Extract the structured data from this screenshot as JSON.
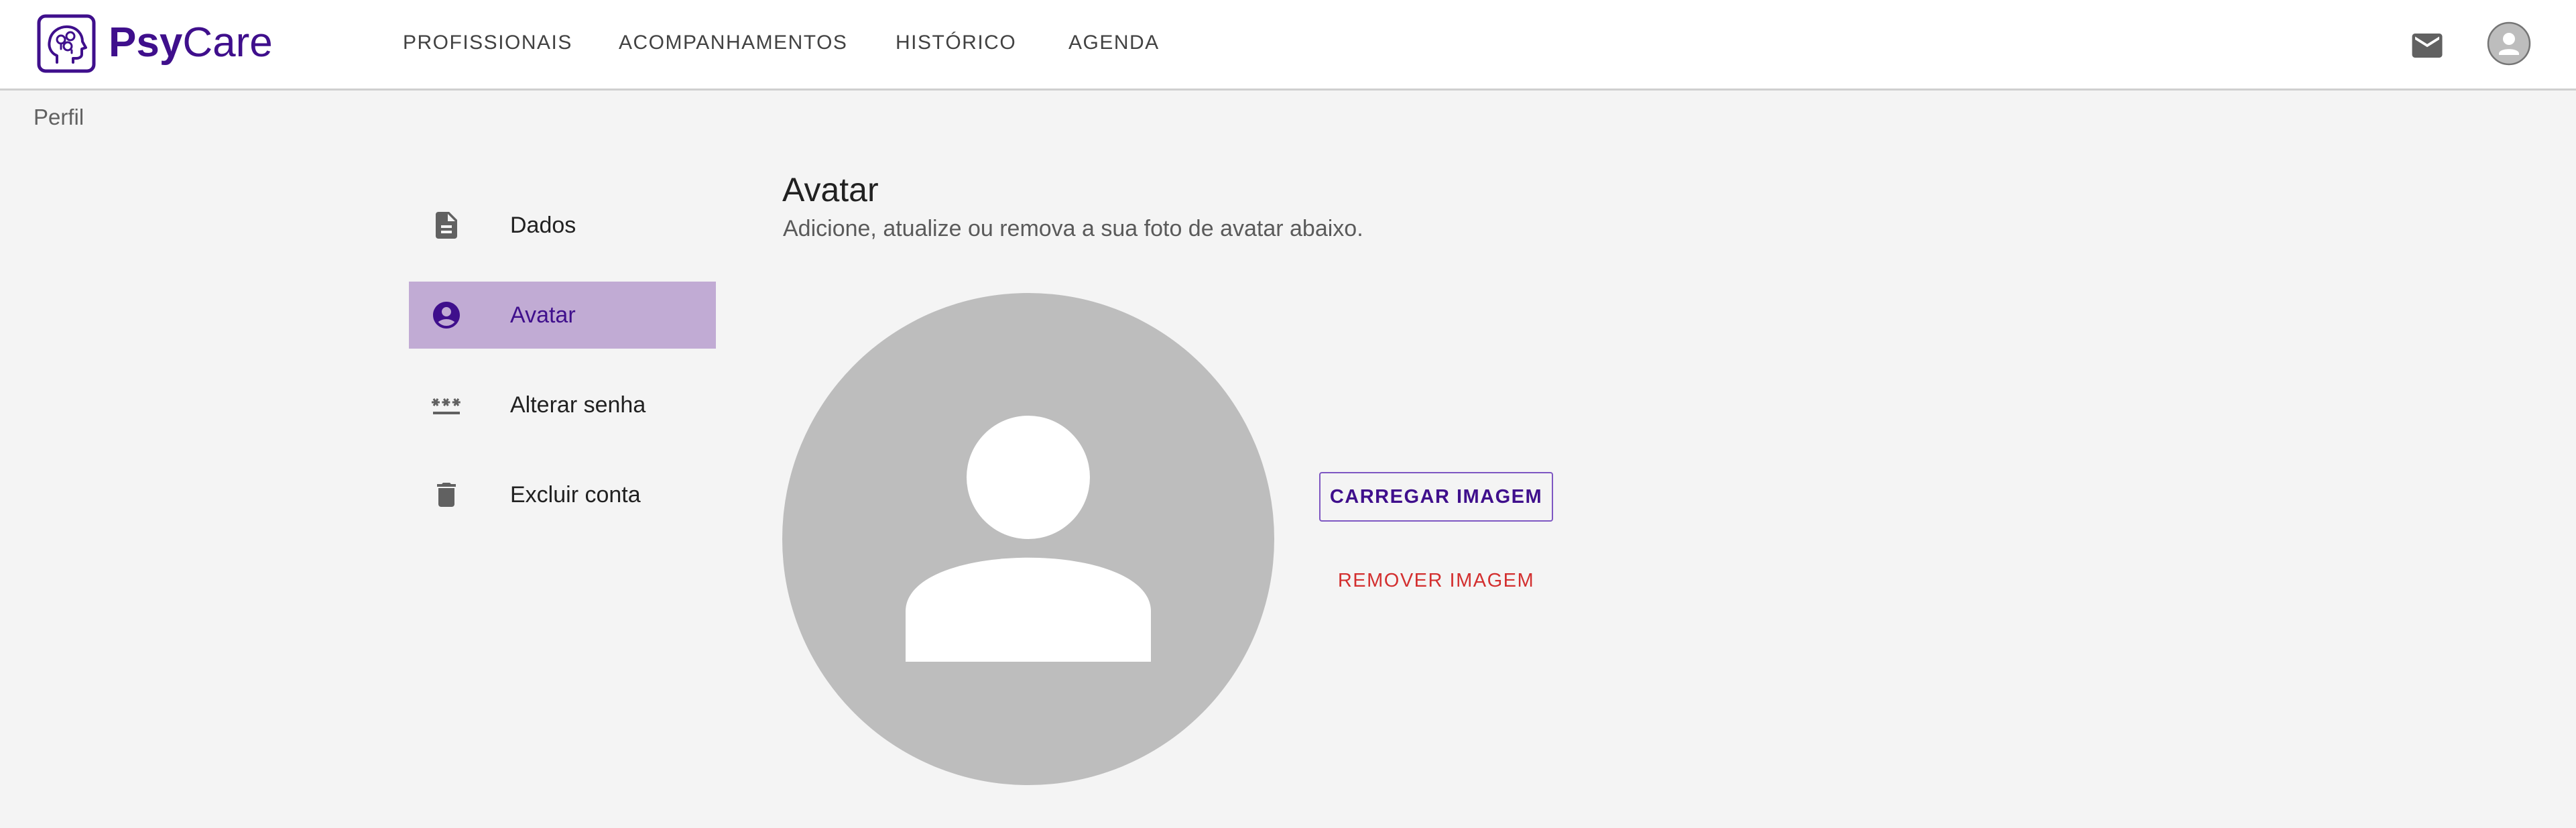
{
  "brand": {
    "part1": "Psy",
    "part2": "Care"
  },
  "nav": [
    {
      "label": "PROFISSIONAIS"
    },
    {
      "label": "ACOMPANHAMENTOS"
    },
    {
      "label": "HISTÓRICO"
    },
    {
      "label": "AGENDA"
    }
  ],
  "header_icons": {
    "mail": "mail-icon",
    "account": "account-circle-icon"
  },
  "breadcrumb": "Perfil",
  "sidebar": {
    "active_index": 1,
    "items": [
      {
        "label": "Dados",
        "icon": "description-icon"
      },
      {
        "label": "Avatar",
        "icon": "account-circle-icon"
      },
      {
        "label": "Alterar senha",
        "icon": "password-icon"
      },
      {
        "label": "Excluir conta",
        "icon": "delete-icon"
      }
    ]
  },
  "section": {
    "title": "Avatar",
    "subtitle": "Adicione, atualize ou remova a sua foto de avatar abaixo."
  },
  "actions": {
    "upload_label": "CARREGAR IMAGEM",
    "remove_label": "REMOVER IMAGEM"
  },
  "colors": {
    "brand": "#3f0f8c",
    "active_bg": "#c1abd4",
    "danger": "#d32f2f",
    "page_bg": "#f4f4f4",
    "avatar_placeholder": "#bdbdbd"
  }
}
